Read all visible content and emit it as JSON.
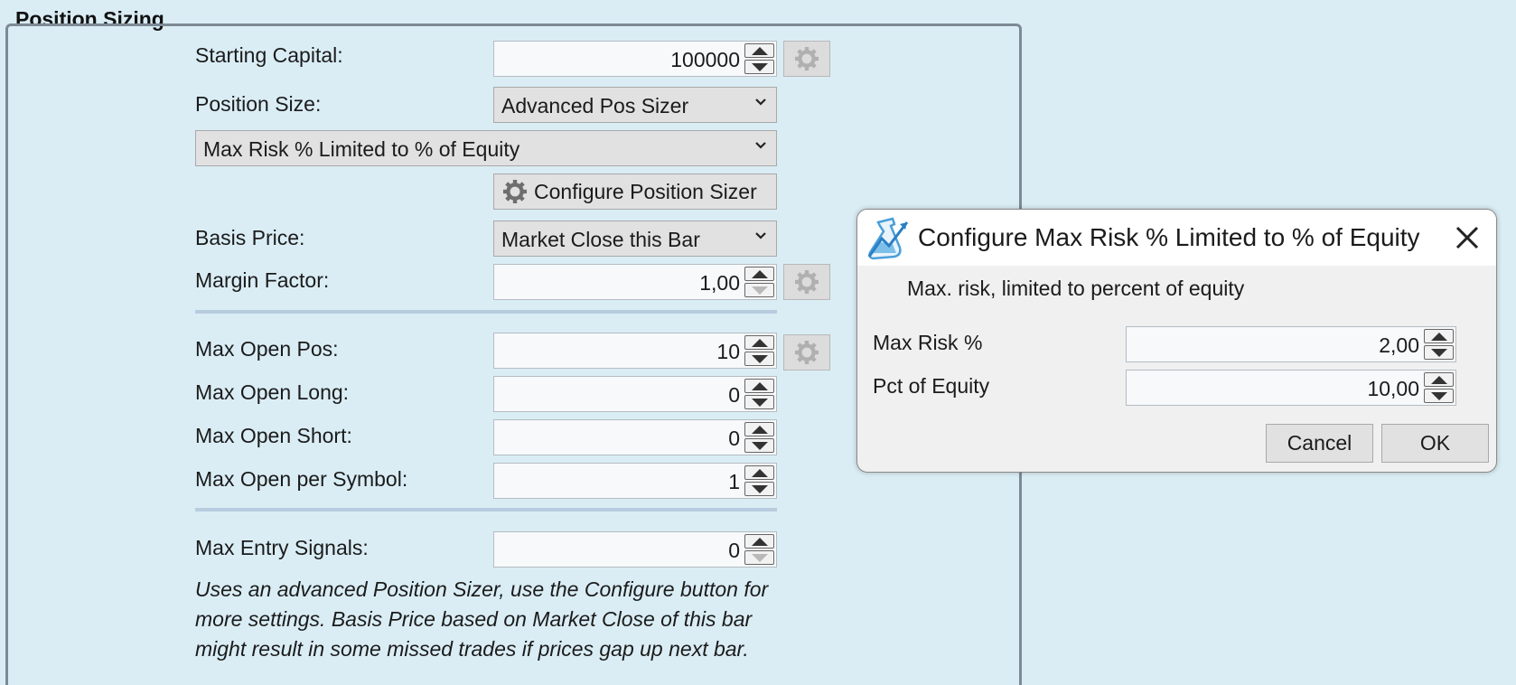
{
  "group": {
    "title": "Position Sizing"
  },
  "starting_capital": {
    "label": "Starting Capital:",
    "value": "100000"
  },
  "position_size": {
    "label": "Position Size:",
    "selected": "Advanced Pos Sizer"
  },
  "sizer_combo": {
    "selected": "Max Risk % Limited to % of Equity"
  },
  "configure_button": {
    "label": "Configure Position Sizer"
  },
  "basis_price": {
    "label": "Basis Price:",
    "selected": "Market Close this Bar"
  },
  "margin_factor": {
    "label": "Margin Factor:",
    "value": "1,00"
  },
  "max_open_pos": {
    "label": "Max Open Pos:",
    "value": "10"
  },
  "max_open_long": {
    "label": "Max Open Long:",
    "value": "0"
  },
  "max_open_short": {
    "label": "Max Open Short:",
    "value": "0"
  },
  "max_open_per_symbol": {
    "label": "Max Open per Symbol:",
    "value": "1"
  },
  "max_entry_signals": {
    "label": "Max Entry Signals:",
    "value": "0"
  },
  "note": "Uses an advanced Position Sizer, use the Configure button for more settings. Basis Price based on Market Close of this bar might result in some missed trades if prices gap up next bar.",
  "dialog": {
    "title": "Configure Max Risk % Limited to % of Equity",
    "description": "Max. risk, limited to percent of equity",
    "max_risk": {
      "label": "Max Risk %",
      "value": "2,00"
    },
    "pct_equity": {
      "label": "Pct of Equity",
      "value": "10,00"
    },
    "cancel_label": "Cancel",
    "ok_label": "OK"
  },
  "icons": [
    "gear-icon",
    "chevron-down-icon",
    "flask-icon",
    "close-icon",
    "spin-up-icon",
    "spin-down-icon"
  ],
  "colors": {
    "background": "#daedf5",
    "button": "#e1e1e1",
    "separator": "#b8cce0",
    "flask_blue": "#4a9fd8"
  }
}
